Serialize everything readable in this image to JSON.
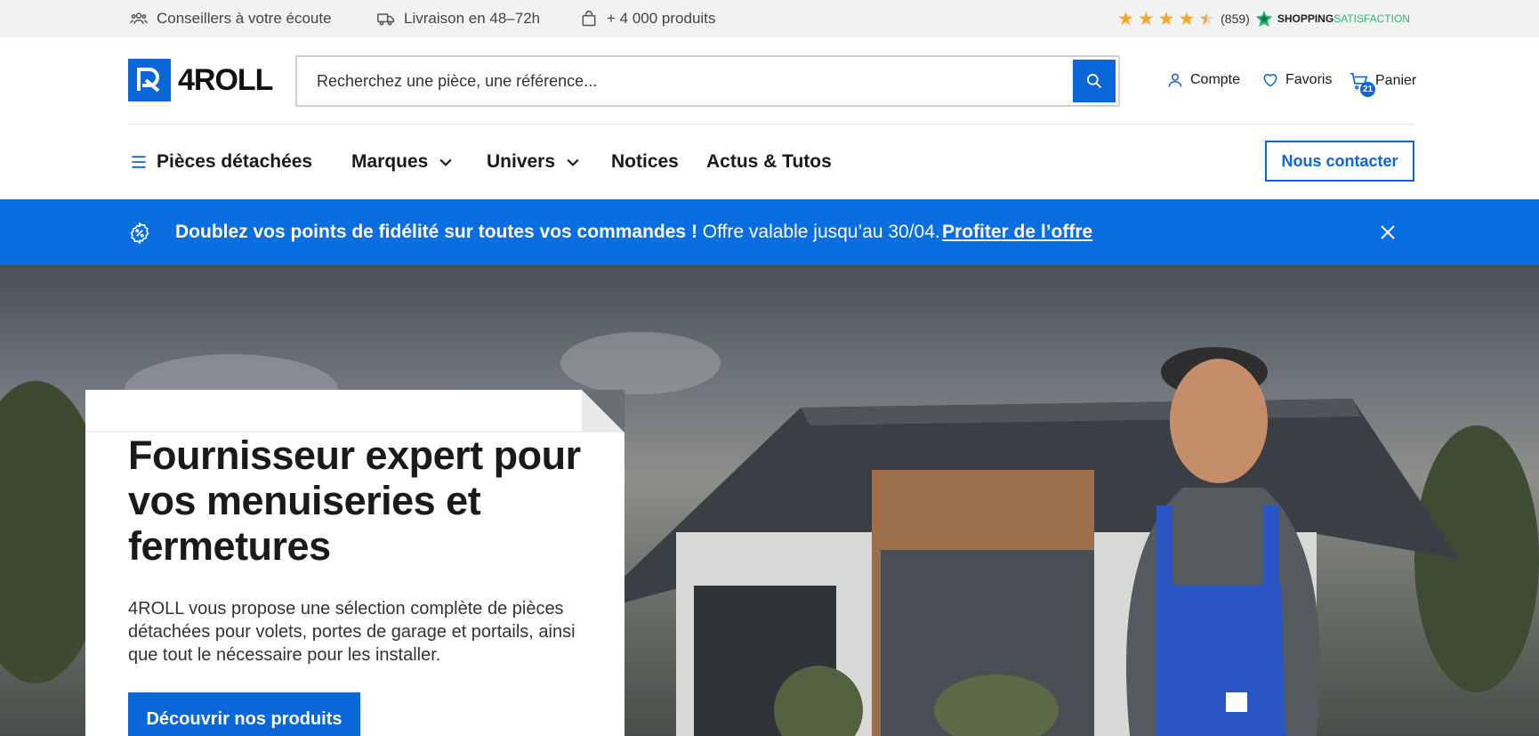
{
  "topbar": {
    "items": [
      {
        "label": "Conseillers à votre écoute",
        "icon": "advisors-icon"
      },
      {
        "label": "Livraison en 48–72h",
        "icon": "truck-icon"
      },
      {
        "label": "+ 4 000 produits",
        "icon": "shopping-bag-icon"
      }
    ],
    "rating": {
      "stars": 4.5,
      "count": "(859)",
      "brand_a": "SHOPPING",
      "brand_b": "SATISFACTION"
    }
  },
  "header": {
    "logo_text": "4ROLL",
    "search_placeholder": "Recherchez une pièce, une référence...",
    "account_label": "Compte",
    "favorites_label": "Favoris",
    "cart_label": "Panier",
    "cart_count": "21"
  },
  "nav": {
    "items": [
      {
        "label": "Pièces détachées"
      },
      {
        "label": "Marques"
      },
      {
        "label": "Univers"
      },
      {
        "label": "Notices"
      },
      {
        "label": "Actus & Tutos"
      }
    ],
    "contact_label": "Nous contacter"
  },
  "promo": {
    "bold_text": "Doublez vos points de fidélité sur toutes vos commandes !",
    "text": " Offre valable jusqu’au 30/04.",
    "link": "Profiter de l’offre"
  },
  "hero": {
    "title": "Fournisseur expert pour vos menuiseries et fermetures",
    "description": "4ROLL vous propose une sélection complète de pièces détachées pour volets, portes de garage et portails, ainsi que tout le nécessaire pour les installer.",
    "cta": "Découvrir nos produits"
  },
  "colors": {
    "brand_blue": "#0b66d8",
    "promo_blue": "#0b6ee0",
    "star": "#f5a623",
    "topbar_bg": "#f2f2f2"
  }
}
